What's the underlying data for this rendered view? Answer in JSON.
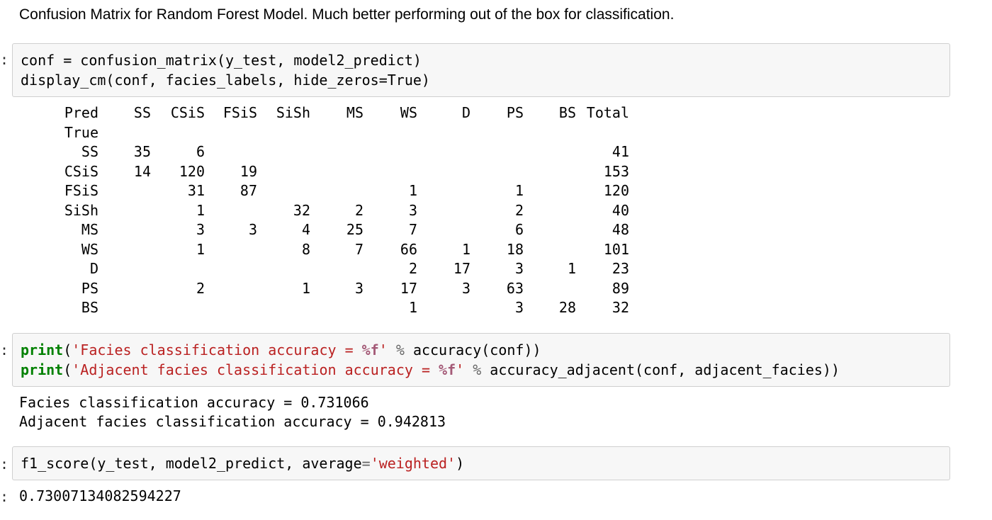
{
  "markdown": {
    "text": "Confusion Matrix for Random Forest Model. Much better performing out of the box for classification."
  },
  "prompt_glyph": ":",
  "cell1": {
    "line1": "conf = confusion_matrix(y_test, model2_predict)",
    "line2": "display_cm(conf, facies_labels, hide_zeros=True)"
  },
  "confusion_matrix": {
    "header": [
      "Pred",
      "SS",
      "CSiS",
      "FSiS",
      "SiSh",
      "MS",
      "WS",
      "D",
      "PS",
      "BS",
      "Total"
    ],
    "row_axis_label": "True",
    "rows": [
      {
        "label": "SS",
        "values": [
          "35",
          "6",
          "",
          "",
          "",
          "",
          "",
          "",
          "",
          "41"
        ]
      },
      {
        "label": "CSiS",
        "values": [
          "14",
          "120",
          "19",
          "",
          "",
          "",
          "",
          "",
          "",
          "153"
        ]
      },
      {
        "label": "FSiS",
        "values": [
          "",
          "31",
          "87",
          "",
          "",
          "1",
          "",
          "1",
          "",
          "120"
        ]
      },
      {
        "label": "SiSh",
        "values": [
          "",
          "1",
          "",
          "32",
          "2",
          "3",
          "",
          "2",
          "",
          "40"
        ]
      },
      {
        "label": "MS",
        "values": [
          "",
          "3",
          "3",
          "4",
          "25",
          "7",
          "",
          "6",
          "",
          "48"
        ]
      },
      {
        "label": "WS",
        "values": [
          "",
          "1",
          "",
          "8",
          "7",
          "66",
          "1",
          "18",
          "",
          "101"
        ]
      },
      {
        "label": "D",
        "values": [
          "",
          "",
          "",
          "",
          "",
          "2",
          "17",
          "3",
          "1",
          "23"
        ]
      },
      {
        "label": "PS",
        "values": [
          "",
          "2",
          "",
          "1",
          "3",
          "17",
          "3",
          "63",
          "",
          "89"
        ]
      },
      {
        "label": "BS",
        "values": [
          "",
          "",
          "",
          "",
          "",
          "1",
          "",
          "3",
          "28",
          "32"
        ]
      }
    ]
  },
  "cell2": {
    "line1": {
      "fn": "print",
      "open": "(",
      "str_a": "'Facies classification accuracy = ",
      "fmt": "%f",
      "str_b": "'",
      "op": " % ",
      "rest": "accuracy(conf))"
    },
    "line2": {
      "fn": "print",
      "open": "(",
      "str_a": "'Adjacent facies classification accuracy = ",
      "fmt": "%f",
      "str_b": "'",
      "op": " % ",
      "rest": "accuracy_adjacent(conf, adjacent_facies))"
    }
  },
  "output2": {
    "line1": "Facies classification accuracy = 0.731066",
    "line2": "Adjacent facies classification accuracy = 0.942813"
  },
  "cell3": {
    "pre": "f1_score(y_test, model2_predict, average",
    "eq": "=",
    "str": "'weighted'",
    "post": ")"
  },
  "output3": {
    "value": "0.73007134082594227"
  }
}
